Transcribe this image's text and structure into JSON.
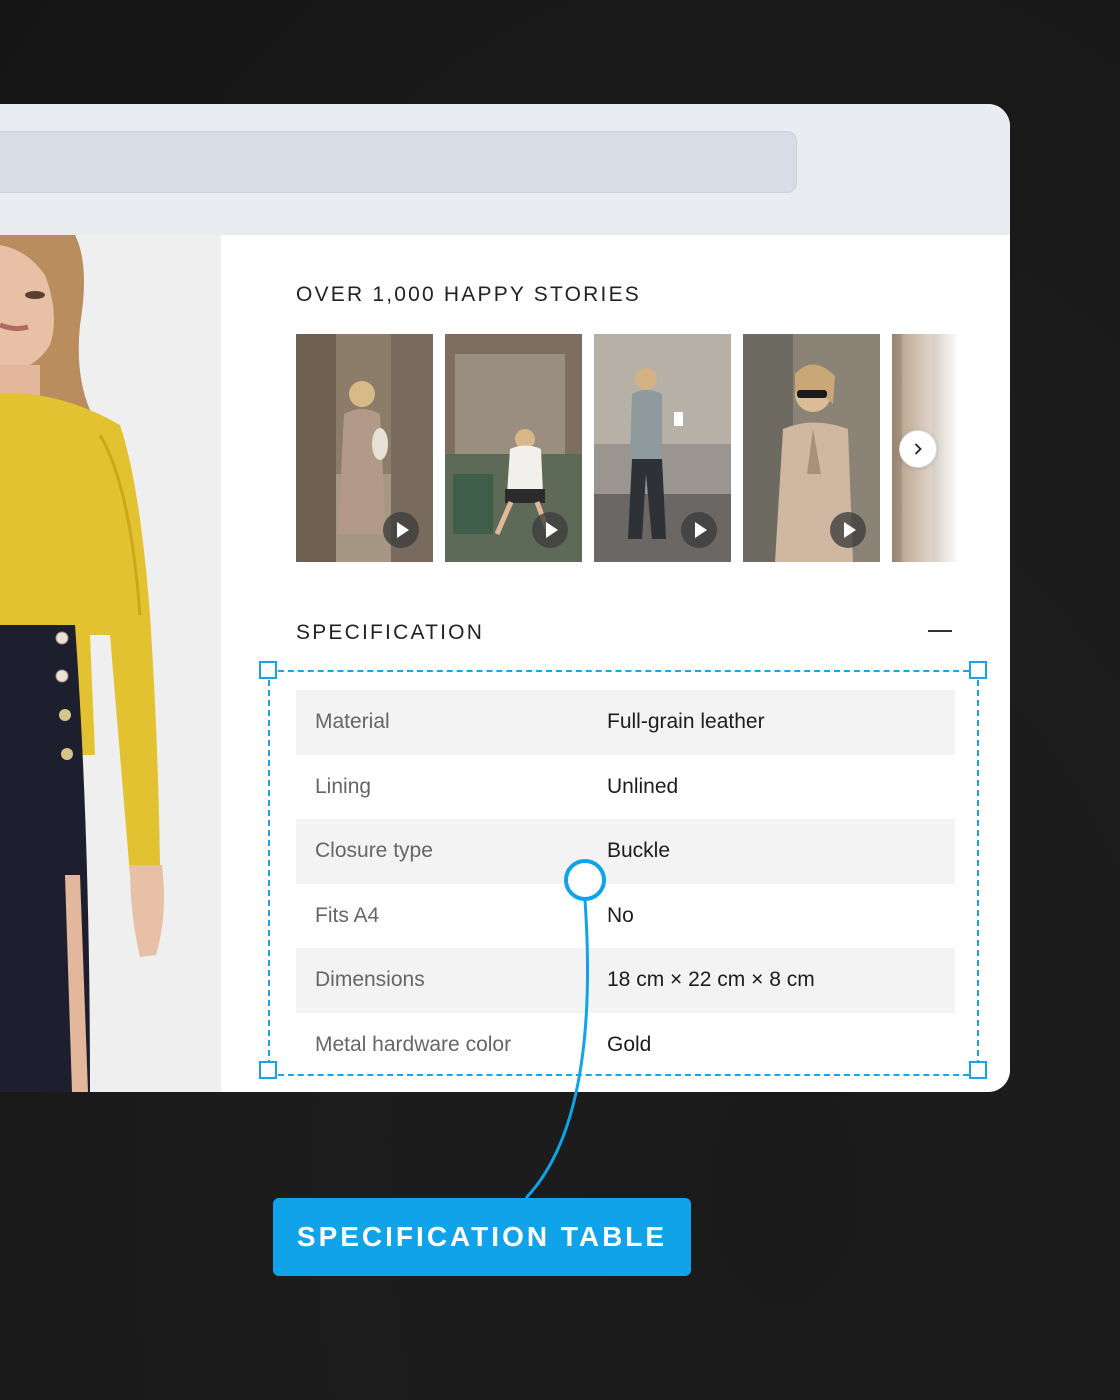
{
  "stories": {
    "title": "OVER 1,000 HAPPY STORIES",
    "thumbnails": [
      {
        "name": "story-video-1"
      },
      {
        "name": "story-video-2"
      },
      {
        "name": "story-video-3"
      },
      {
        "name": "story-video-4"
      },
      {
        "name": "story-video-5"
      }
    ],
    "next_icon": "chevron-right-icon"
  },
  "specification": {
    "title": "SPECIFICATION",
    "collapse_icon": "minus-icon",
    "rows": [
      {
        "key": "Material",
        "value": "Full-grain leather"
      },
      {
        "key": "Lining",
        "value": "Unlined"
      },
      {
        "key": "Closure type",
        "value": "Buckle"
      },
      {
        "key": "Fits A4",
        "value": "No"
      },
      {
        "key": "Dimensions",
        "value": "18 cm × 22 cm × 8 cm"
      },
      {
        "key": "Metal hardware color",
        "value": "Gold"
      }
    ]
  },
  "annotation": {
    "label": "SPECIFICATION TABLE",
    "color": "#10a3e9"
  }
}
